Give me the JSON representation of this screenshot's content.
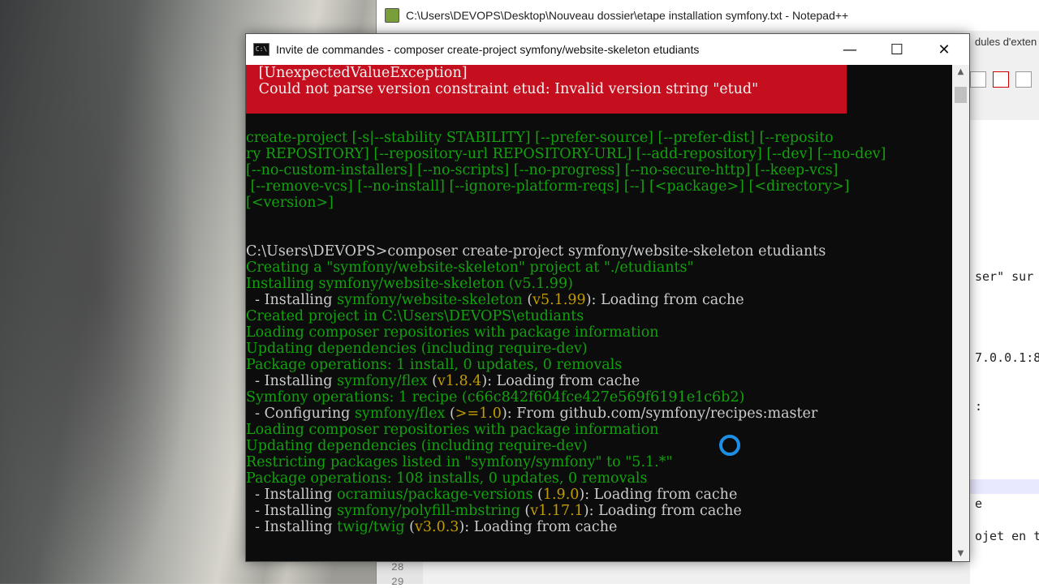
{
  "notepad": {
    "title": "C:\\Users\\DEVOPS\\Desktop\\Nouveau dossier\\etape installation symfony.txt - Notepad++",
    "tab_fragment": "dules d'exten",
    "editor_fragments": [
      "ser\" sur",
      "7.0.0.1:8",
      ":",
      "e",
      "ojet en t"
    ],
    "line_numbers": [
      "28",
      "29"
    ]
  },
  "cmd": {
    "title": "Invite de commandes - composer  create-project symfony/website-skeleton etudiants",
    "buttons": {
      "minimize": "—",
      "maximize": "☐",
      "close": "✕"
    },
    "error": {
      "line1": " [UnexpectedValueException]",
      "line2": " Could not parse version constraint etud: Invalid version string \"etud\""
    },
    "usage": [
      "create-project [-s|--stability STABILITY] [--prefer-source] [--prefer-dist] [--reposito",
      "ry REPOSITORY] [--repository-url REPOSITORY-URL] [--add-repository] [--dev] [--no-dev]",
      "[--no-custom-installers] [--no-scripts] [--no-progress] [--no-secure-http] [--keep-vcs]",
      " [--remove-vcs] [--no-install] [--ignore-platform-reqs] [--] [<package>] [<directory>]",
      "[<version>]"
    ],
    "prompt": "C:\\Users\\DEVOPS>composer create-project symfony/website-skeleton etudiants",
    "output": [
      {
        "text": "Creating a \"symfony/website-skeleton\" project at \"./etudiants\""
      },
      {
        "text": "Installing symfony/website-skeleton (v5.1.99)"
      },
      {
        "prefix": "  - Installing ",
        "pkg": "symfony/website-skeleton",
        "version": "v5.1.99",
        "suffix": "): Loading from cache"
      },
      {
        "text": "Created project in C:\\Users\\DEVOPS\\etudiants"
      },
      {
        "text": "Loading composer repositories with package information"
      },
      {
        "text": "Updating dependencies (including require-dev)"
      },
      {
        "text": "Package operations: 1 install, 0 updates, 0 removals"
      },
      {
        "prefix": "  - Installing ",
        "pkg": "symfony/flex",
        "version": "v1.8.4",
        "suffix": "): Loading from cache"
      },
      {
        "text": "Symfony operations: 1 recipe (c66c842f604fce427e569f6191e1c6b2)"
      },
      {
        "prefix": "  - Configuring ",
        "pkg": "symfony/flex",
        "version": ">=1.0",
        "suffix": "): From github.com/symfony/recipes:master"
      },
      {
        "text": "Loading composer repositories with package information"
      },
      {
        "text": "Updating dependencies (including require-dev)"
      },
      {
        "text": "Restricting packages listed in \"symfony/symfony\" to \"5.1.*\""
      },
      {
        "text": "Package operations: 108 installs, 0 updates, 0 removals"
      },
      {
        "prefix": "  - Installing ",
        "pkg": "ocramius/package-versions",
        "version": "1.9.0",
        "suffix": "): Loading from cache"
      },
      {
        "prefix": "  - Installing ",
        "pkg": "symfony/polyfill-mbstring",
        "version": "v1.17.1",
        "suffix": "): Loading from cache"
      },
      {
        "prefix": "  - Installing ",
        "pkg": "twig/twig",
        "version": "v3.0.3",
        "suffix": "): Loading from cache"
      }
    ],
    "colors": {
      "green": "#13a10e",
      "white": "#cccccc",
      "yellow": "#c19c00",
      "error_bg": "#c50f1f"
    }
  }
}
